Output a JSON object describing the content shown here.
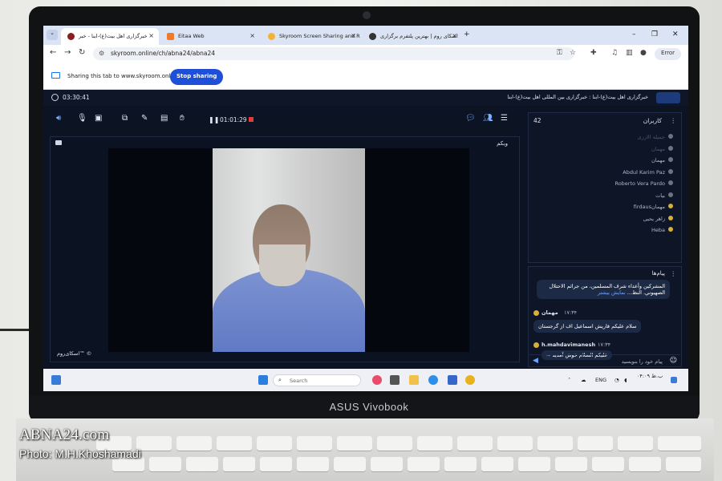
{
  "browser": {
    "tabs": [
      {
        "label": "خبرگزاری اهل بیت(ع)-ابنا - خبر"
      },
      {
        "label": "Eitaa Web"
      },
      {
        "label": "Skyroom Screen Sharing and R"
      },
      {
        "label": "اسکای روم | بهترین پلتفرم برگزاری"
      }
    ],
    "new_tab": "+",
    "url": "skyroom.online/ch/abna24/abna24",
    "error_button": "Error",
    "sharing_text": "Sharing this tab to www.skyroom.online",
    "stop_sharing": "Stop sharing"
  },
  "app": {
    "session_time": "03:30:41",
    "news_title": "خبرگزاری اهل بیت(ع)-ابنا : خبرگزاری بین المللی اهل بیت(ع)-ابنا",
    "recording_timer": "01:01:29",
    "webcam_label": "وبکم",
    "watermark": "اسکای‌روم™ ©",
    "users": {
      "title": "کاربران",
      "count": "42",
      "items": [
        {
          "name": "جمیله الازری",
          "dim": true
        },
        {
          "name": "مهمان",
          "dim": true
        },
        {
          "name": "مهمان",
          "dim": false
        },
        {
          "name": "Abdul Karim Paz",
          "dim": false
        },
        {
          "name": "Roberto Vera Pardo",
          "dim": false
        },
        {
          "name": "بیات",
          "dim": false
        },
        {
          "name": "firdausمهمان",
          "dim": false
        },
        {
          "name": "زاهر یحیی",
          "dim": false
        },
        {
          "name": "Heba",
          "dim": false
        }
      ]
    },
    "messages": {
      "title": "پیام‌ها",
      "first_message": "المشركين وأعداء شرف المسلمين، من جرائم الاحتلال الصهيوني. النظ...",
      "show_more": "نمایش بیشتر",
      "m2_sender": "مهمان",
      "m2_time": "۱۷:۳۴",
      "m2_text": "سلام علیکم قاریش اسماعیل اف از گرجستان",
      "m3_sender": "h.mahdavimanesh",
      "m3_time": "۱۷:۳۴",
      "m3_text": "علیکم السلام خوش آمدید ~",
      "input_placeholder": "پیام خود را بنویسید"
    }
  },
  "taskbar": {
    "search_placeholder": "Search",
    "lang": "ENG",
    "date_time": "۰۴:۰۹ ب.ظ"
  },
  "device": {
    "brand": "ASUS Vivobook"
  },
  "credit": {
    "site": "ABNA24.com",
    "photo": "Photo: M.H.Khoshamadi"
  }
}
